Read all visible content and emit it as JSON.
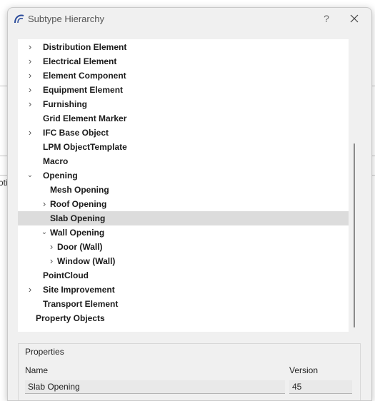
{
  "window": {
    "title": "Subtype Hierarchy",
    "help_label": "?",
    "close_icon": "close-icon"
  },
  "background": {
    "fragment_text": "oti"
  },
  "tree": {
    "items": [
      {
        "label": "Distribution Element",
        "level": 1,
        "expander": "collapsed"
      },
      {
        "label": "Electrical Element",
        "level": 1,
        "expander": "collapsed"
      },
      {
        "label": "Element Component",
        "level": 1,
        "expander": "collapsed"
      },
      {
        "label": "Equipment Element",
        "level": 1,
        "expander": "collapsed"
      },
      {
        "label": "Furnishing",
        "level": 1,
        "expander": "collapsed"
      },
      {
        "label": "Grid Element Marker",
        "level": 1,
        "expander": "none"
      },
      {
        "label": "IFC Base Object",
        "level": 1,
        "expander": "collapsed"
      },
      {
        "label": "LPM ObjectTemplate",
        "level": 1,
        "expander": "none"
      },
      {
        "label": "Macro",
        "level": 1,
        "expander": "none"
      },
      {
        "label": "Opening",
        "level": 1,
        "expander": "expanded"
      },
      {
        "label": "Mesh Opening",
        "level": 2,
        "expander": "none"
      },
      {
        "label": "Roof Opening",
        "level": 2,
        "expander": "collapsed"
      },
      {
        "label": "Slab Opening",
        "level": 2,
        "expander": "none",
        "selected": true
      },
      {
        "label": "Wall Opening",
        "level": 2,
        "expander": "expanded"
      },
      {
        "label": "Door (Wall)",
        "level": 3,
        "expander": "collapsed"
      },
      {
        "label": "Window (Wall)",
        "level": 3,
        "expander": "collapsed"
      },
      {
        "label": "PointCloud",
        "level": 1,
        "expander": "none"
      },
      {
        "label": "Site Improvement",
        "level": 1,
        "expander": "collapsed"
      },
      {
        "label": "Transport Element",
        "level": 1,
        "expander": "none"
      },
      {
        "label": "Property Objects",
        "level": 0,
        "expander": "none"
      }
    ]
  },
  "properties": {
    "title": "Properties",
    "name_label": "Name",
    "version_label": "Version",
    "name_value": "Slab Opening",
    "version_value": "45"
  }
}
